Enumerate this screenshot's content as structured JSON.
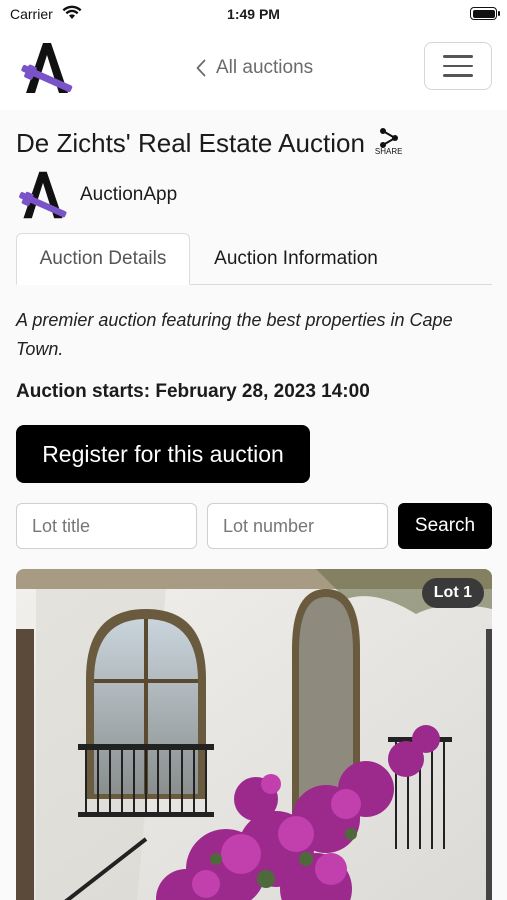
{
  "status_bar": {
    "carrier": "Carrier",
    "time": "1:49 PM"
  },
  "nav": {
    "back_label": "All auctions"
  },
  "auction": {
    "title": "De Zichts' Real Estate Auction",
    "share_label": "SHARE",
    "organizer": "AuctionApp",
    "description": "A premier auction featuring the best properties in Cape Town.",
    "starts_text": "Auction starts: February 28, 2023 14:00"
  },
  "tabs": [
    {
      "label": "Auction Details",
      "active": true
    },
    {
      "label": "Auction Information",
      "active": false
    }
  ],
  "register_label": "Register for this auction",
  "search": {
    "title_placeholder": "Lot title",
    "number_placeholder": "Lot number",
    "button_label": "Search"
  },
  "lots": [
    {
      "badge": "Lot 1"
    }
  ],
  "colors": {
    "brand_purple": "#7b53c9",
    "brand_black": "#000000",
    "accent_button": "#000000"
  },
  "icons": [
    "wifi-icon",
    "battery-icon",
    "chevron-left-icon",
    "hamburger-icon",
    "share-icon",
    "auctionapp-logo"
  ]
}
